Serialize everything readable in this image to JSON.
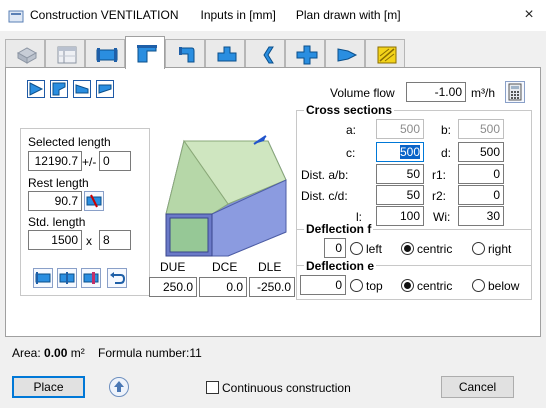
{
  "window": {
    "title": "Construction VENTILATION",
    "inputs_unit": "Inputs in [mm]",
    "plan_unit": "Plan drawn with  [m]",
    "close_glyph": "×"
  },
  "tabs": [
    "box-icon",
    "table-icon",
    "duct-icon",
    "transition-icon",
    "bend-icon",
    "tee-icon",
    "s-bend-icon",
    "cross-icon",
    "cone-icon",
    "hatch-icon"
  ],
  "volume_flow": {
    "label": "Volume flow",
    "value": "-1.00",
    "unit": "m³/h"
  },
  "lengths": {
    "selected_label": "Selected length",
    "selected_value": "12190.7",
    "tolerance_sign": "+/-",
    "tolerance_value": "0",
    "rest_label": "Rest length",
    "rest_value": "90.7",
    "std_label": "Std. length",
    "std_value": "1500",
    "times": "x",
    "count": "8"
  },
  "cross_sections": {
    "title": "Cross sections",
    "a_label": "a:",
    "a_value": "500",
    "b_label": "b:",
    "b_value": "500",
    "c_label": "c:",
    "c_value": "500",
    "d_label": "d:",
    "d_value": "500",
    "dist_ab_label": "Dist. a/b:",
    "dist_ab_value": "50",
    "r1_label": "r1:",
    "r1_value": "0",
    "dist_cd_label": "Dist. c/d:",
    "dist_cd_value": "50",
    "r2_label": "r2:",
    "r2_value": "0",
    "l_label": "l:",
    "l_value": "100",
    "wi_label": "Wi:",
    "wi_value": "30"
  },
  "deflection_f": {
    "title": "Deflection f",
    "value": "0",
    "left": "left",
    "centric": "centric",
    "right": "right",
    "selected": "centric"
  },
  "deflection_e": {
    "title": "Deflection e",
    "value": "0",
    "top": "top",
    "centric": "centric",
    "below": "below",
    "selected": "centric"
  },
  "offsets": {
    "due_label": "DUE",
    "due_value": "250.0",
    "dce_label": "DCE",
    "dce_value": "0.0",
    "dle_label": "DLE",
    "dle_value": "-250.0"
  },
  "status": {
    "area_label": "Area:",
    "area_value": "0.00",
    "area_unit": "m²",
    "formula": "Formula number:11"
  },
  "footer": {
    "place_label": "Place",
    "continuous_label": "Continuous construction",
    "continuous_checked": false,
    "cancel_label": "Cancel"
  },
  "colors": {
    "accent": "#0078d7",
    "focus": "#0a64c8",
    "duct_blue": "#7f8fd6",
    "duct_green": "#cfe6c0"
  }
}
